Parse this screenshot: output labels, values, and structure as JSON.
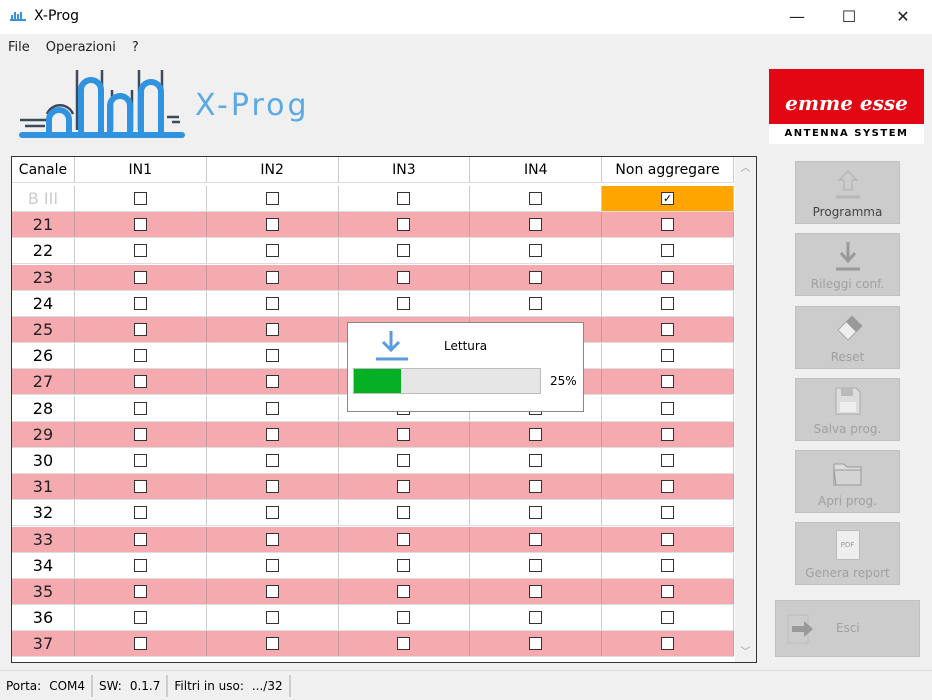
{
  "window": {
    "title": "X-Prog",
    "minimize": "—",
    "maximize": "☐",
    "close": "✕"
  },
  "menu": [
    "File",
    "Operazioni",
    "?"
  ],
  "logo_text": "X-Prog",
  "brand": {
    "name": "emme esse",
    "tagline": "ANTENNA SYSTEM"
  },
  "table": {
    "headers": [
      "Canale",
      "IN1",
      "IN2",
      "IN3",
      "IN4",
      "Non aggregare"
    ],
    "rows": [
      {
        "canale": "B III",
        "checks": [
          false,
          false,
          false,
          false,
          true
        ],
        "disabled": true
      },
      {
        "canale": "21",
        "checks": [
          false,
          false,
          false,
          false,
          false
        ]
      },
      {
        "canale": "22",
        "checks": [
          false,
          false,
          false,
          false,
          false
        ]
      },
      {
        "canale": "23",
        "checks": [
          false,
          false,
          false,
          false,
          false
        ]
      },
      {
        "canale": "24",
        "checks": [
          false,
          false,
          false,
          false,
          false
        ]
      },
      {
        "canale": "25",
        "checks": [
          false,
          false,
          false,
          false,
          false
        ]
      },
      {
        "canale": "26",
        "checks": [
          false,
          false,
          false,
          false,
          false
        ]
      },
      {
        "canale": "27",
        "checks": [
          false,
          false,
          false,
          false,
          false
        ]
      },
      {
        "canale": "28",
        "checks": [
          false,
          false,
          false,
          false,
          false
        ]
      },
      {
        "canale": "29",
        "checks": [
          false,
          false,
          false,
          false,
          false
        ]
      },
      {
        "canale": "30",
        "checks": [
          false,
          false,
          false,
          false,
          false
        ]
      },
      {
        "canale": "31",
        "checks": [
          false,
          false,
          false,
          false,
          false
        ]
      },
      {
        "canale": "32",
        "checks": [
          false,
          false,
          false,
          false,
          false
        ]
      },
      {
        "canale": "33",
        "checks": [
          false,
          false,
          false,
          false,
          false
        ]
      },
      {
        "canale": "34",
        "checks": [
          false,
          false,
          false,
          false,
          false
        ]
      },
      {
        "canale": "35",
        "checks": [
          false,
          false,
          false,
          false,
          false
        ]
      },
      {
        "canale": "36",
        "checks": [
          false,
          false,
          false,
          false,
          false
        ]
      },
      {
        "canale": "37",
        "checks": [
          false,
          false,
          false,
          false,
          false
        ]
      }
    ]
  },
  "progress": {
    "title": "Lettura",
    "percent": 25,
    "label": "25%"
  },
  "buttons": {
    "programma": "Programma",
    "rileggi": "Rileggi conf.",
    "reset": "Reset",
    "salva": "Salva prog.",
    "apri": "Apri prog.",
    "report": "Genera report",
    "report_icon_text": "PDF",
    "esci": "Esci"
  },
  "status": {
    "porta_label": "Porta:",
    "porta": "COM4",
    "sw_label": "SW:",
    "sw": "0.1.7",
    "filtri_label": "Filtri in uso:",
    "filtri": ".../32"
  },
  "colors": {
    "pink": "#f5aab0",
    "orange": "#ffa500",
    "progress": "#06b025",
    "accent": "#5aa9e6"
  }
}
